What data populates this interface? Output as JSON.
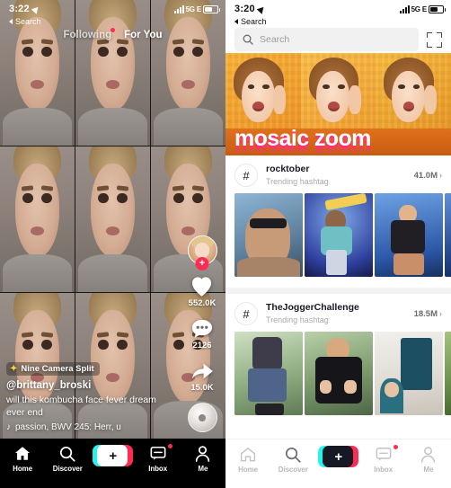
{
  "left_phone": {
    "status": {
      "time": "3:22",
      "back_label": "Search",
      "network": "5G E",
      "location_icon": "location-arrow-icon"
    },
    "feed_tabs": [
      {
        "label": "Following",
        "active": false,
        "has_badge": true
      },
      {
        "label": "For You",
        "active": true,
        "has_badge": false
      }
    ],
    "effect_badge": {
      "icon": "sparkle-icon",
      "label": "Nine Camera Split"
    },
    "author": "@brittany_broski",
    "description": "will this kombucha face fever dream ever end",
    "music": {
      "icon": "music-note-icon",
      "label": "passion, BWV 245: Herr, u"
    },
    "actions": {
      "follow_label": "+",
      "like_count": "552.0K",
      "comment_count": "2126",
      "share_count": "15.0K",
      "avatar_name": "avatar",
      "disc_name": "album-disc"
    },
    "nav": [
      {
        "label": "Home",
        "icon": "home-icon",
        "active": true,
        "badge": false
      },
      {
        "label": "Discover",
        "icon": "search-icon",
        "active": false,
        "badge": false
      },
      {
        "label": "",
        "icon": "create-plus-icon",
        "active": false,
        "badge": false,
        "is_create": true,
        "create_glyph": "+"
      },
      {
        "label": "Inbox",
        "icon": "message-icon",
        "active": false,
        "badge": true
      },
      {
        "label": "Me",
        "icon": "person-icon",
        "active": false,
        "badge": false
      }
    ]
  },
  "right_phone": {
    "status": {
      "time": "3:20",
      "back_label": "Search",
      "network": "5G E",
      "location_icon": "location-arrow-icon"
    },
    "search": {
      "placeholder": "Search",
      "value": "",
      "icon": "search-icon",
      "scan_icon": "qr-scan-icon"
    },
    "banner": {
      "title": "mosaic zoom"
    },
    "sections": [
      {
        "hash_icon": "hashtag-icon",
        "title": "rocktober",
        "subtitle": "Trending hashtag",
        "count": "41.0M",
        "chevron": "›"
      },
      {
        "hash_icon": "hashtag-icon",
        "title": "TheJoggerChallenge",
        "subtitle": "Trending hashtag",
        "count": "18.5M",
        "chevron": "›"
      }
    ],
    "nav": [
      {
        "label": "Home",
        "icon": "home-icon",
        "active": false,
        "badge": false
      },
      {
        "label": "Discover",
        "icon": "search-icon",
        "active": true,
        "badge": false
      },
      {
        "label": "",
        "icon": "create-plus-icon",
        "active": false,
        "badge": false,
        "is_create": true,
        "create_glyph": "+"
      },
      {
        "label": "Inbox",
        "icon": "message-icon",
        "active": false,
        "badge": true
      },
      {
        "label": "Me",
        "icon": "person-icon",
        "active": false,
        "badge": false
      }
    ]
  },
  "colors": {
    "brand_red": "#fe2c55",
    "brand_cyan": "#25f4ee",
    "banner_orange": "#f4a93a",
    "banner_pink": "#ff2e7e",
    "text_dark": "#161823",
    "text_muted": "#a9a9b0"
  }
}
